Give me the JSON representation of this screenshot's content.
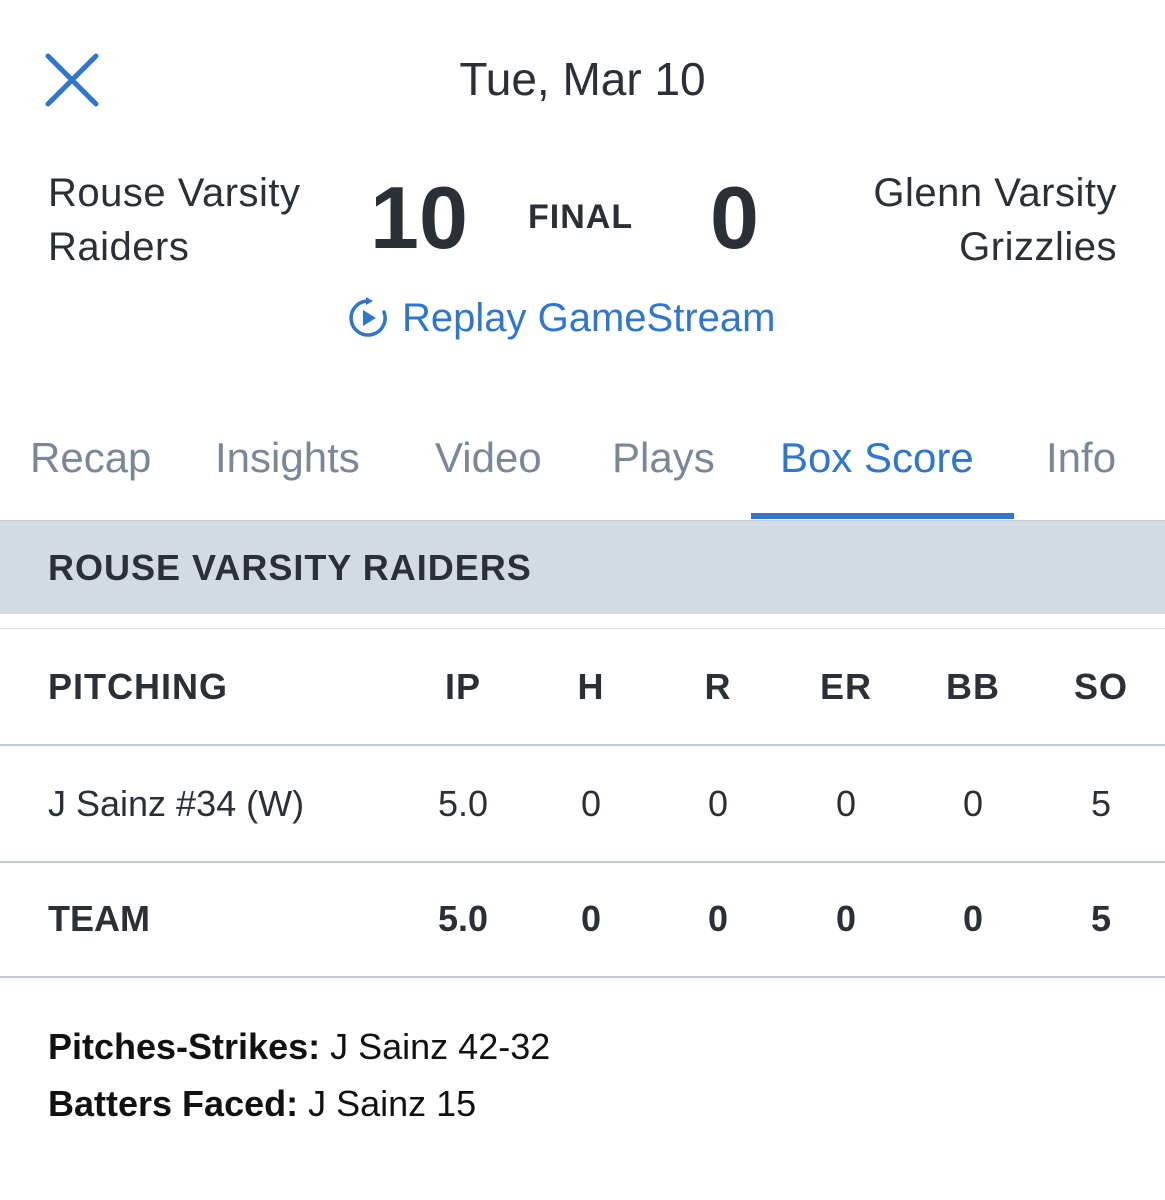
{
  "header": {
    "close_icon": "close-icon",
    "date": "Tue, Mar 10"
  },
  "game": {
    "home_team_line1": "Rouse Varsity",
    "home_team_line2": "Raiders",
    "home_score": "10",
    "status": "FINAL",
    "away_score": "0",
    "away_team_line1": "Glenn Varsity",
    "away_team_line2": "Grizzlies",
    "replay_label": "Replay GameStream",
    "replay_icon": "replay-play-icon"
  },
  "tabs": [
    {
      "label": "Recap"
    },
    {
      "label": "Insights"
    },
    {
      "label": "Video"
    },
    {
      "label": "Plays"
    },
    {
      "label": "Box Score"
    },
    {
      "label": "Info"
    }
  ],
  "active_tab": "Box Score",
  "box_score": {
    "team_name": "ROUSE VARSITY RAIDERS",
    "columns": [
      "PITCHING",
      "IP",
      "H",
      "R",
      "ER",
      "BB",
      "SO"
    ],
    "rows": [
      {
        "name": "J Sainz #34 (W)",
        "ip": "5.0",
        "h": "0",
        "r": "0",
        "er": "0",
        "bb": "0",
        "so": "5"
      }
    ],
    "total": {
      "name": "TEAM",
      "ip": "5.0",
      "h": "0",
      "r": "0",
      "er": "0",
      "bb": "0",
      "so": "5"
    },
    "notes": [
      {
        "label": "Pitches-Strikes:",
        "value": " J Sainz 42-32"
      },
      {
        "label": "Batters Faced:",
        "value": " J Sainz 15"
      }
    ]
  },
  "colors": {
    "accent": "#2f76d0",
    "text": "#2b2f36",
    "tab_inactive": "#7a8799",
    "section_bg": "#d3dbe2"
  }
}
